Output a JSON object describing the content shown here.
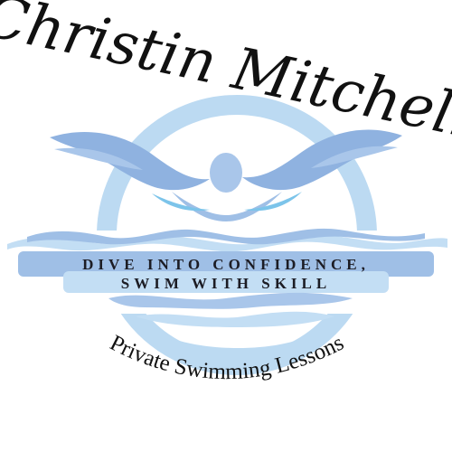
{
  "brand": {
    "name": "Christin Mitchell",
    "tagline_line1": "DIVE INTO CONFIDENCE,",
    "tagline_line2": "SWIM WITH SKILL",
    "subtitle": "Private Swimming Lessons"
  },
  "colors": {
    "ring": "#bcdaf2",
    "wave_dark": "#9fbfe6",
    "wave_mid": "#8fb2e0",
    "wave_light": "#c3def4",
    "accent_cyan": "#7cc4ea",
    "swimmer": "#a9c6ea",
    "text_dark": "#1c1c24",
    "signature": "#111111"
  },
  "icons": {
    "emblem": "swimmer-emblem-icon"
  }
}
